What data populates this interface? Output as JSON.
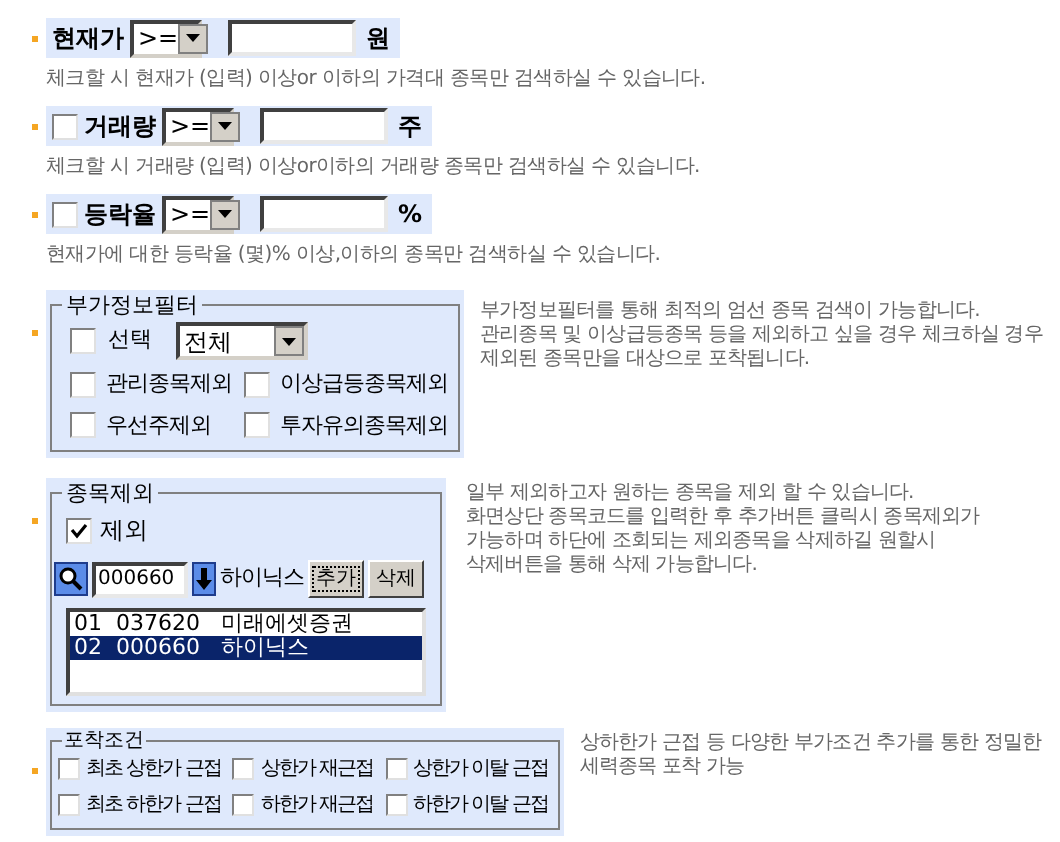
{
  "filters": [
    {
      "kind": "plain",
      "label": "현재가",
      "operator": ">=",
      "unit": "원",
      "description": "체크할 시 현재가 (입력) 이상or 이하의 가격대 종목만 검색하실 수 있습니다."
    },
    {
      "kind": "checkbox",
      "checked": false,
      "label": "거래량",
      "operator": ">=",
      "unit": "주",
      "description": "체크할 시 거래량 (입력) 이상or이하의 거래량 종목만 검색하실 수 있습니다."
    },
    {
      "kind": "checkbox",
      "checked": false,
      "label": "등락율",
      "operator": ">=",
      "unit": "%",
      "description": "현재가에 대한 등락율 (몇)% 이상,이하의 종목만 검색하실 수 있습니다."
    }
  ],
  "extra_info_filter": {
    "legend": "부가정보필터",
    "select": {
      "label": "선택",
      "checked": false,
      "value": "전체"
    },
    "options": [
      {
        "label": "관리종목제외",
        "checked": false
      },
      {
        "label": "이상급등종목제외",
        "checked": false
      },
      {
        "label": "우선주제외",
        "checked": false
      },
      {
        "label": "투자유의종목제외",
        "checked": false
      }
    ],
    "description": [
      "부가정보필터를 통해 최적의 엄선 종목 검색이 가능합니다.",
      "관리종목 및 이상급등종목 등을 제외하고 싶을 경우 체크하실 경우",
      "제외된 종목만을 대상으로 포착됩니다."
    ]
  },
  "stock_exclusion": {
    "legend": "종목제외",
    "exclude": {
      "label": "제외",
      "checked": true
    },
    "code": "000660",
    "name": "하이닉스",
    "buttons": [
      {
        "label": "추가",
        "focused": true
      },
      {
        "label": "삭제",
        "focused": false
      }
    ],
    "list": [
      {
        "text": "01  037620   미래에셋증권",
        "selected": false
      },
      {
        "text": "02  000660   하이닉스",
        "selected": true
      }
    ],
    "description": [
      "일부 제외하고자 원하는 종목을 제외 할 수 있습니다.",
      "화면상단 종목코드를 입력한 후 추가버튼 클릭시 종목제외가",
      "가능하며  하단에 조회되는 제외종목을 삭제하길 원할시",
      "삭제버튼을 통해 삭제 가능합니다."
    ]
  },
  "capture_conditions": {
    "legend": "포착조건",
    "options": [
      {
        "label": "최초 상한가 근접",
        "checked": false
      },
      {
        "label": "상한가 재근접",
        "checked": false
      },
      {
        "label": "상한가 이탈 근접",
        "checked": false
      },
      {
        "label": "최초 하한가 근접",
        "checked": false
      },
      {
        "label": "하한가 재근접",
        "checked": false
      },
      {
        "label": "하한가 이탈 근접",
        "checked": false
      }
    ],
    "description": [
      "상하한가 근접 등 다양한 부가조건 추가를 통한 정밀한",
      "세력종목 포착 가능"
    ]
  }
}
